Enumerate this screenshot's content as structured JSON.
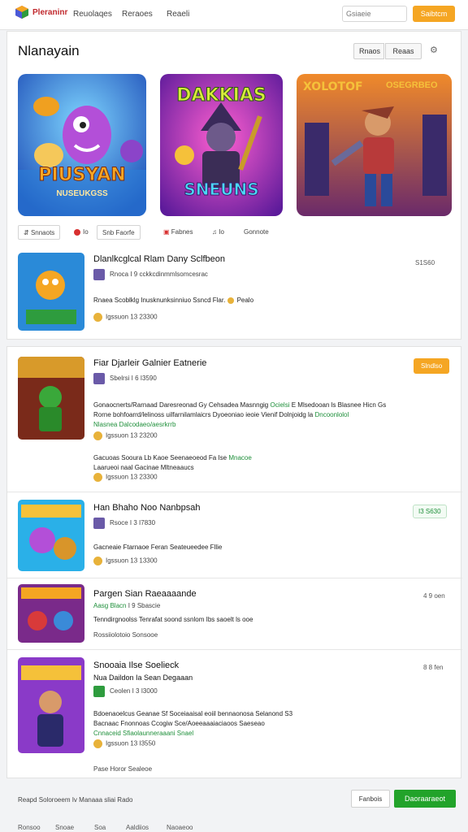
{
  "topnav": {
    "brand": "Pleraninr",
    "links": [
      "Reuolaqes",
      "Reraoes",
      "Reaeli"
    ],
    "search_placeholder": "Gsiaeie",
    "signin": "Saibtcm"
  },
  "header": {
    "title": "Nlanayain",
    "seg_a": "Rnaos",
    "seg_b": "Reaas",
    "settings": "⚙"
  },
  "banners": [
    {
      "title": "PIUSYAN",
      "subtitle": "NUSEUKGSS",
      "accent": "#f5a623"
    },
    {
      "title": "DAKKIAS",
      "subtitle": "SNEUNS",
      "accent": "#d8ec3a"
    },
    {
      "title": "XOLOTOF",
      "subtitle": "OSEGRBEO",
      "accent": "#f5c13a"
    }
  ],
  "chips": {
    "a": "Snnaots",
    "b": "Io",
    "c": "Snb Faorfe",
    "d": "Fabnes",
    "e": "Io",
    "f": "Gonnote"
  },
  "games": [
    {
      "title": "Dlanlkcglcal Rlam Dany Sclfbeon",
      "meta": "Rnoca I 9 cckkcdinmmlsomcesrac",
      "desc": "Rnaea Scoblklg Inusknunksinniuo Ssncd Flar.",
      "desc_tail": "Pealo",
      "foot": "Igssuon  13    23300",
      "score": "S1S60"
    },
    {
      "title": "Fiar Djarleir Galnier Eatnerie",
      "meta": "Sbelrsi I 6 I3590",
      "desc1": "Gonaocnerts/Rarnaad Daresreonad Gy Cehsadea Masnngig",
      "desc1_green": "Ocielsi",
      "desc1_tail": "E Mlsedooan ls Blasnee Hicn Gs",
      "desc2": "Rorne bohfoarrd/lelinoss uilfarnilamlaicrs Dyoeoniao ieoie Vienif Dolnjoidg la",
      "desc2_green": "Dncoonlolol",
      "desc3": "Nlasnea Dalcodaeo/aesrkrrb",
      "foot1": "Igssuon  13    23200",
      "desc4": "Gacuoas Sooura Lb Kaoe Seenaeoeod Fa Ise",
      "desc4_green": "Mnacoe",
      "desc5": "Laarueoi naal Gacinae Mltneaaucs",
      "foot2": "Igssuon  13    23300",
      "badge": "Slndlso"
    },
    {
      "title": "Han Bhaho Noo Nanbpsah",
      "meta": "Rsoce I 3 I7830",
      "desc": "Gacneaie Ftarnaoe Feran Seateueedee Fllie",
      "foot": "Igssuon  13    13300",
      "score": "I3 S630"
    },
    {
      "title": "Pargen Sian Raeaaaande",
      "meta_green": "Aasg Blacn",
      "meta_tail": "I 9 Sbascie",
      "desc": "Tenndirgnoolss Tenrafat soond ssnlom Ibs saoelt ls ooe",
      "foot": "Rossiiolotoio  Sonsooe",
      "score": "4 9 oen"
    },
    {
      "title": "Snooaia Ilse Soelieck",
      "sub": "Nua Daildon Ia Sean Degaaan",
      "meta": "Ceolen I 3 I3000",
      "desc1": "Bdoenaoelcus Geanae Sf Soceiaaisal eoiil bennaonosa Selanond S3",
      "desc2": "Bacnaac Fnonnoas Ccogiw Sce/Aoeeaaaiaciaoos Saeseao",
      "desc3_green": "Cnnaceid Sfiaolaunneraaani Snael",
      "foot": "Igssuon  13    I3550",
      "foot2": "Pase Horor  Sealeoe",
      "score": "8 8 fen"
    }
  ],
  "footer": {
    "text": "Reapd Soloroeem Iv Manaaa sliai Rado",
    "btn_a": "Fanbois",
    "btn_b": "Daoraaraeot",
    "links": [
      "Ronsoo",
      "Snoae",
      "Soa",
      "Aaldiios",
      "Naoaeoo"
    ]
  }
}
